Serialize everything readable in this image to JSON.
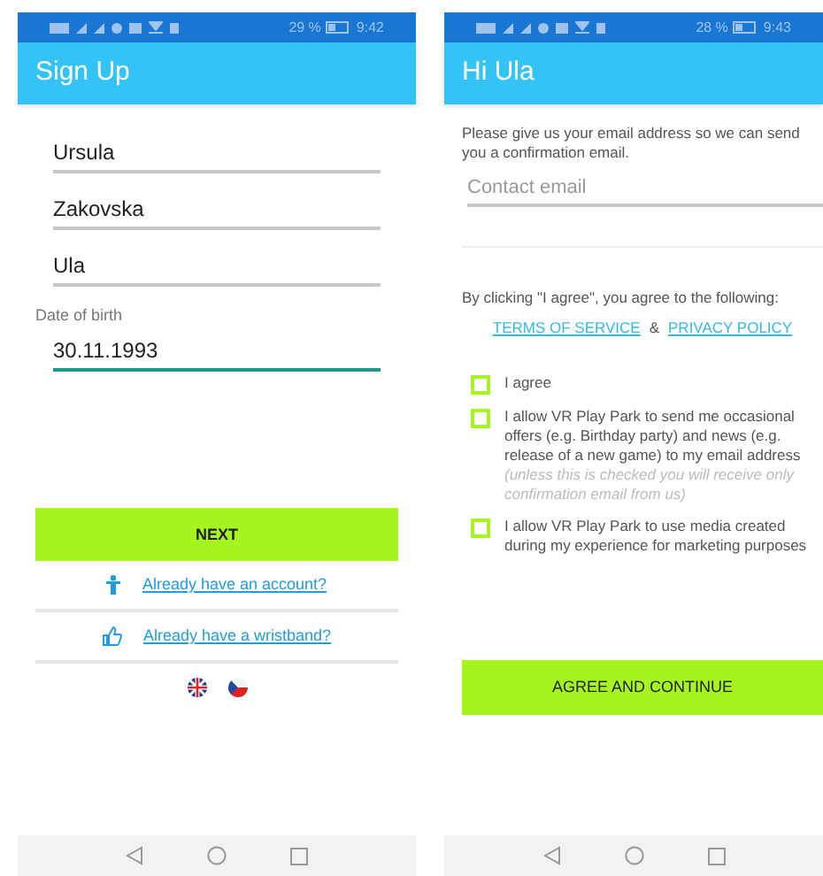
{
  "screens": [
    {
      "status_bar": {
        "battery": "29 %",
        "time": "9:42"
      },
      "title": "Sign Up",
      "fields": [
        {
          "value": "Ursula",
          "focused": false
        },
        {
          "value": "Zakovska",
          "focused": false
        },
        {
          "value": "Ula",
          "focused": false
        },
        {
          "label": "Date of birth",
          "value": "30.11.1993",
          "focused": true
        }
      ],
      "button": "NEXT",
      "links": [
        {
          "kind": "account",
          "text": "Already have an account?"
        },
        {
          "kind": "wristband",
          "text": "Already have a wristband?"
        }
      ],
      "languages": [
        {
          "kind": "en"
        },
        {
          "kind": "cz"
        }
      ]
    },
    {
      "status_bar": {
        "battery": "28 %",
        "time": "9:43"
      },
      "title": "Hi Ula",
      "intro": "Please give us your email address so we can send you a confirmation email.",
      "email": {
        "placeholder": "Contact email"
      },
      "agree_text": "By clicking \"I agree\", you agree to the following:",
      "terms": "TERMS OF SERVICE",
      "amp": "&",
      "privacy": "PRIVACY POLICY",
      "checkboxes": [
        {
          "label": "I agree",
          "checked": false
        },
        {
          "label": "I allow VR Play Park to send me occasional offers (e.g. Birthday party) and news (e.g. release of a new game) to my email address",
          "note": "(unless this is checked you will receive only confirmation email from us)",
          "checked": false
        },
        {
          "label": "I allow VR Play Park to use media created during my experience for marketing purposes",
          "checked": false
        }
      ],
      "button": "AGREE AND CONTINUE"
    }
  ]
}
